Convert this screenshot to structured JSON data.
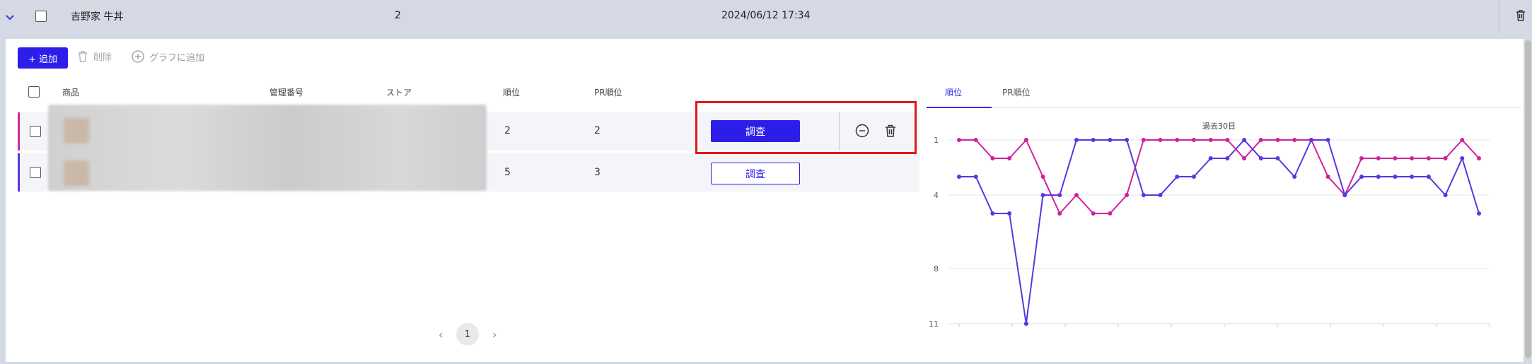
{
  "parent_row": {
    "name": "吉野家 牛丼",
    "count": "2",
    "date": "2024/06/12 17:34"
  },
  "toolbar": {
    "add_label": "+ 追加",
    "delete_label": "削除",
    "add_graph_label": "グラフに追加"
  },
  "table": {
    "headers": [
      "商品",
      "管理番号",
      "ストア",
      "順位",
      "PR順位"
    ],
    "rows": [
      {
        "rank": "2",
        "pr_rank": "2",
        "action_label": "調査",
        "accent": "#cc2a96"
      },
      {
        "rank": "5",
        "pr_rank": "3",
        "action_label": "調査",
        "accent": "#5b35e0"
      }
    ]
  },
  "pagination": {
    "current": "1"
  },
  "chart_tabs": {
    "active": "順位",
    "inactive": "PR順位"
  },
  "chart_data": {
    "type": "line",
    "title": "過去30日",
    "y_ticks": [
      "1",
      "4",
      "8",
      "11"
    ],
    "ylim": [
      1,
      11
    ],
    "y_inverted": true,
    "series": [
      {
        "color": "#d0219c",
        "values": [
          1,
          1,
          2,
          2,
          1,
          3,
          5,
          4,
          5,
          5,
          4,
          1,
          1,
          1,
          1,
          1,
          1,
          2,
          1,
          1,
          1,
          1,
          3,
          4,
          2,
          2,
          2,
          2,
          2,
          2,
          1,
          2
        ]
      },
      {
        "color": "#5b35e0",
        "values": [
          3,
          3,
          5,
          5,
          11,
          4,
          4,
          1,
          1,
          1,
          1,
          4,
          4,
          3,
          3,
          2,
          2,
          1,
          2,
          2,
          3,
          1,
          1,
          4,
          3,
          3,
          3,
          3,
          3,
          4,
          2,
          5
        ]
      }
    ]
  }
}
